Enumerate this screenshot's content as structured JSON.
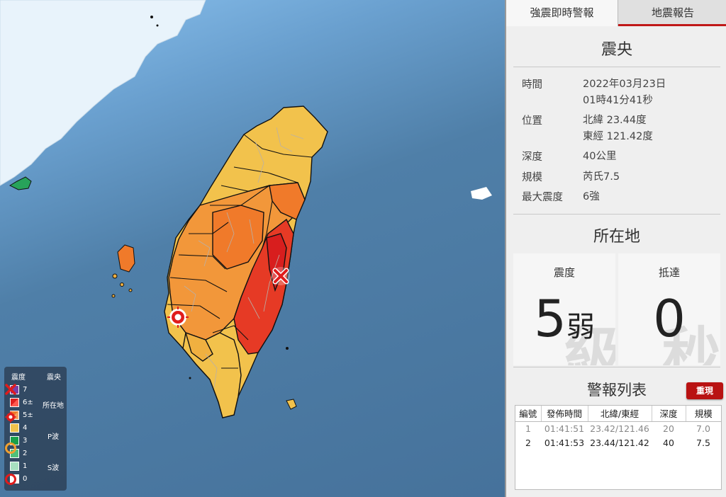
{
  "tabs": [
    {
      "label": "強震即時警報",
      "active": true
    },
    {
      "label": "地震報告",
      "active": false
    }
  ],
  "epicenter": {
    "title": "震央",
    "time_label": "時間",
    "time_date": "2022年03月23日",
    "time_clock": "01時41分41秒",
    "position_label": "位置",
    "lat": "北緯 23.44度",
    "lon": "東經 121.42度",
    "depth_label": "深度",
    "depth": "40公里",
    "magnitude_label": "規模",
    "magnitude": "芮氏7.5",
    "max_intensity_label": "最大震度",
    "max_intensity": "6強"
  },
  "location": {
    "title": "所在地",
    "intensity_label": "震度",
    "intensity_value": "5",
    "intensity_suffix": "弱",
    "intensity_ghost": "級",
    "arrival_label": "抵達",
    "arrival_value": "0",
    "arrival_ghost": "秒"
  },
  "alerts": {
    "title": "警報列表",
    "replay_label": "重現",
    "columns": [
      "編號",
      "發佈時間",
      "北緯/東經",
      "深度",
      "規模"
    ],
    "rows": [
      [
        "1",
        "01:41:51",
        "23.42/121.46",
        "20",
        "7.0"
      ],
      [
        "2",
        "01:41:53",
        "23.44/121.42",
        "40",
        "7.5"
      ]
    ]
  },
  "legend": {
    "intensity_header": "震度",
    "epicenter_header": "震央",
    "location_label": "所在地",
    "p_wave_label": "P波",
    "s_wave_label": "S波",
    "levels": [
      {
        "label": "7",
        "color": "#7b3fa6"
      },
      {
        "label": "6±",
        "color": "#e02020"
      },
      {
        "label": "5±",
        "color": "#f07a2a"
      },
      {
        "label": "4",
        "color": "#f2c24c"
      },
      {
        "label": "3",
        "color": "#1aa04a"
      },
      {
        "label": "2",
        "color": "#4fc07a"
      },
      {
        "label": "1",
        "color": "#a8e0c0"
      },
      {
        "label": "0",
        "color": "#ffffff"
      }
    ]
  },
  "colors": {
    "accent_red": "#c01818",
    "sea": "#4f7fa8",
    "land_china": "#e6f2fb"
  },
  "icons": [
    "epicenter-x-icon",
    "location-target-icon",
    "p-wave-ring-icon",
    "s-wave-ring-icon"
  ]
}
